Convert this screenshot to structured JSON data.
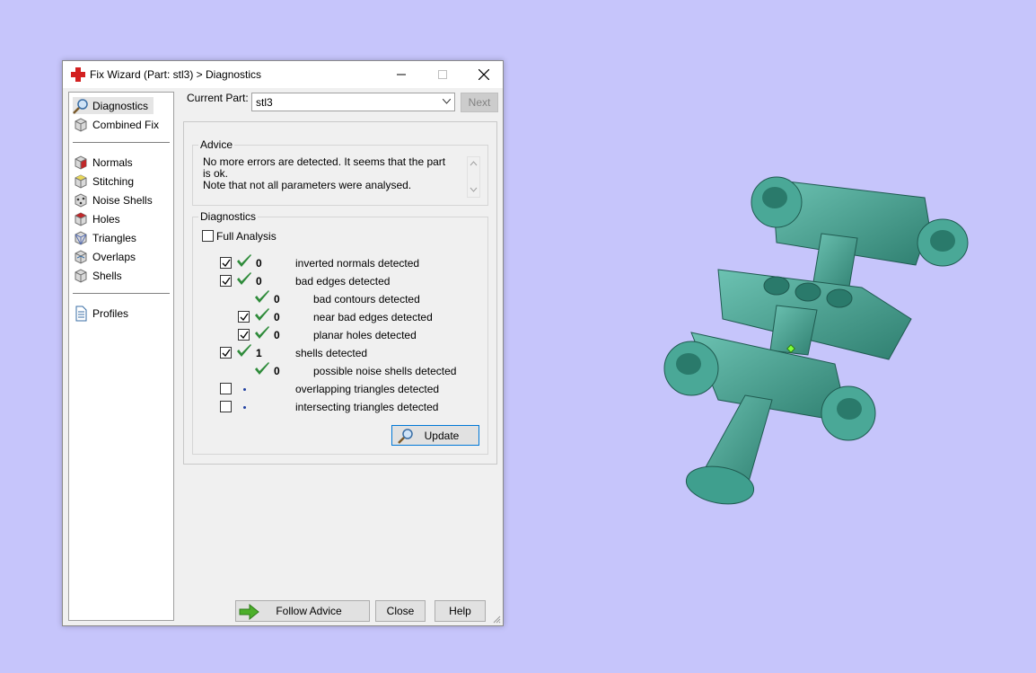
{
  "window": {
    "title": "Fix Wizard (Part: stl3) > Diagnostics"
  },
  "sidebar": {
    "items": [
      {
        "label": "Diagnostics",
        "icon": "magnifier-icon",
        "selected": true
      },
      {
        "label": "Combined Fix",
        "icon": "cube-icon"
      },
      {
        "label": "Normals",
        "icon": "normals-cube-icon"
      },
      {
        "label": "Stitching",
        "icon": "stitching-cube-icon"
      },
      {
        "label": "Noise Shells",
        "icon": "noise-shells-icon"
      },
      {
        "label": "Holes",
        "icon": "holes-cube-icon"
      },
      {
        "label": "Triangles",
        "icon": "triangles-cube-icon"
      },
      {
        "label": "Overlaps",
        "icon": "overlaps-cube-icon"
      },
      {
        "label": "Shells",
        "icon": "shells-cube-icon"
      },
      {
        "label": "Profiles",
        "icon": "document-icon"
      }
    ]
  },
  "current_part": {
    "label": "Current Part:",
    "value": "stl3",
    "next_label": "Next"
  },
  "advice": {
    "title": "Advice",
    "line1": "No more errors are detected. It seems that the part is ok.",
    "line2": "Note that not all parameters were analysed."
  },
  "diagnostics": {
    "title": "Diagnostics",
    "full_analysis_label": "Full Analysis",
    "full_analysis_checked": false,
    "rows": [
      {
        "text": "inverted normals detected",
        "count": "0",
        "checked": true,
        "status": "ok"
      },
      {
        "text": "bad edges detected",
        "count": "0",
        "checked": true,
        "status": "ok"
      },
      {
        "text": "bad contours detected",
        "count": "0",
        "checked": null,
        "status": "ok"
      },
      {
        "text": "near bad edges detected",
        "count": "0",
        "checked": true,
        "status": "ok"
      },
      {
        "text": "planar holes detected",
        "count": "0",
        "checked": true,
        "status": "ok"
      },
      {
        "text": "shells detected",
        "count": "1",
        "checked": true,
        "status": "ok"
      },
      {
        "text": "possible noise shells detected",
        "count": "0",
        "checked": null,
        "status": "ok"
      },
      {
        "text": "overlapping triangles detected",
        "count": "",
        "checked": false,
        "status": "pending"
      },
      {
        "text": "intersecting triangles detected",
        "count": "",
        "checked": false,
        "status": "pending"
      }
    ],
    "update_label": "Update"
  },
  "footer": {
    "follow_advice_label": "Follow Advice",
    "close_label": "Close",
    "help_label": "Help"
  },
  "colors": {
    "background": "#c6c5fb",
    "model": "#3f9f8e",
    "check_green": "#2e8b3a"
  }
}
